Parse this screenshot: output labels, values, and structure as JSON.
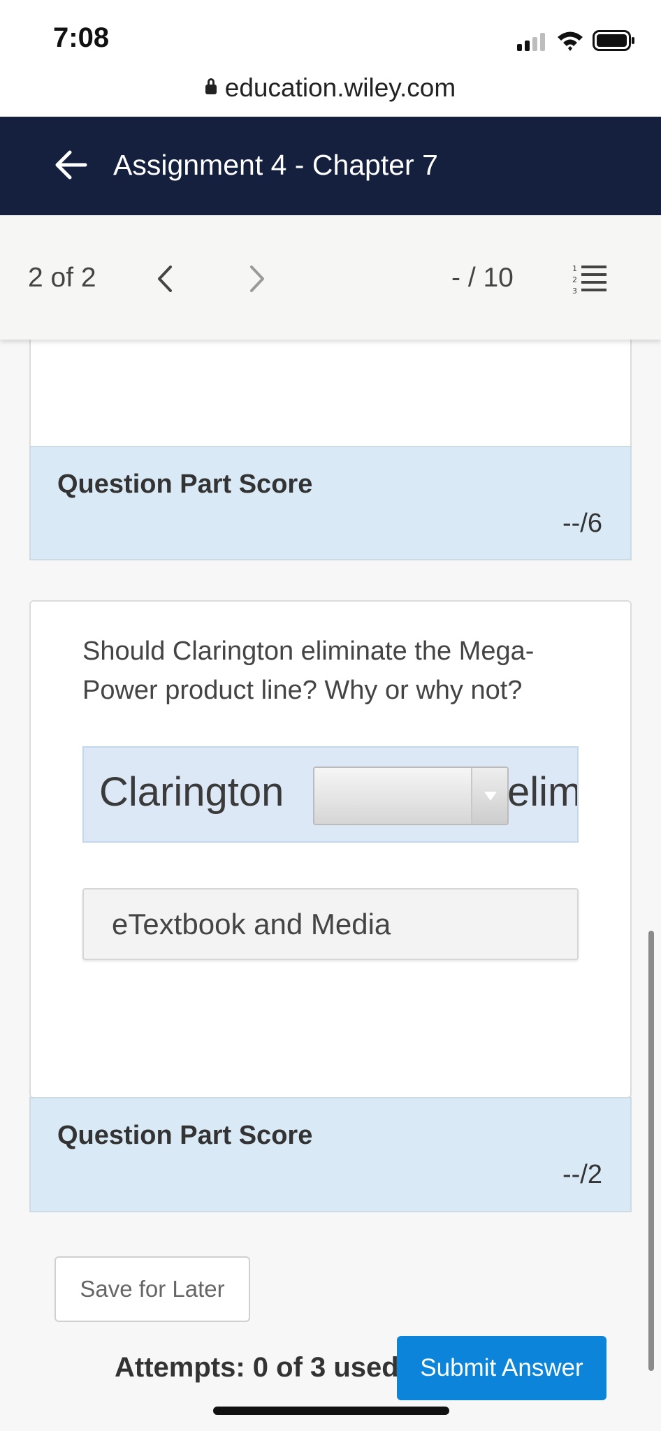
{
  "status_bar": {
    "time": "7:08",
    "url": "education.wiley.com"
  },
  "header": {
    "title": "Assignment 4 - Chapter 7"
  },
  "nav": {
    "page_count": "2 of 2",
    "points": "- / 10"
  },
  "part1_score": {
    "label": "Question Part Score",
    "value": "--/6"
  },
  "question": {
    "text": "Should Clarington eliminate the Mega-Power product line? Why or why not?",
    "answer_prefix": "Clarington",
    "dropdown_selected": "",
    "answer_suffix": "elim",
    "etextbook_label": "eTextbook and Media"
  },
  "part2_score": {
    "label": "Question Part Score",
    "value": "--/2"
  },
  "footer": {
    "save_label": "Save for Later",
    "attempts": "Attempts: 0 of 3 used",
    "submit_label": "Submit Answer"
  },
  "colors": {
    "header_bg": "#15203f",
    "score_bg": "#d9eaf6",
    "submit_bg": "#0b84d9"
  }
}
